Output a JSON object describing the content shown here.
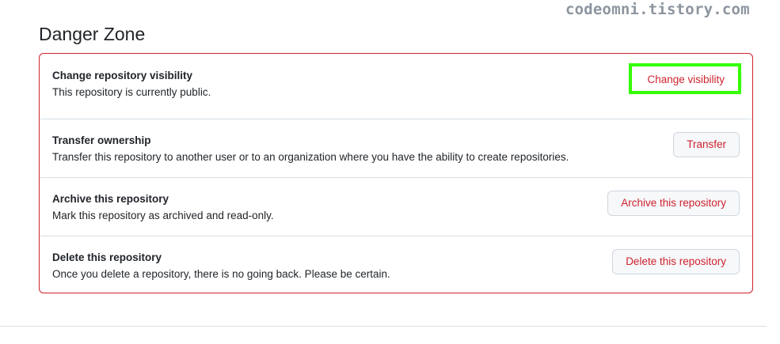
{
  "watermark": "codeomni.tistory.com",
  "section": {
    "title": "Danger Zone"
  },
  "rows": [
    {
      "title": "Change repository visibility",
      "description": "This repository is currently public.",
      "button": "Change visibility"
    },
    {
      "title": "Transfer ownership",
      "description": "Transfer this repository to another user or to an organization where you have the ability to create repositories.",
      "button": "Transfer"
    },
    {
      "title": "Archive this repository",
      "description": "Mark this repository as archived and read-only.",
      "button": "Archive this repository"
    },
    {
      "title": "Delete this repository",
      "description": "Once you delete a repository, there is no going back. Please be certain.",
      "button": "Delete this repository"
    }
  ],
  "colors": {
    "danger": "#cf222e",
    "highlight": "#33ff00",
    "border": "#d0d7de"
  }
}
